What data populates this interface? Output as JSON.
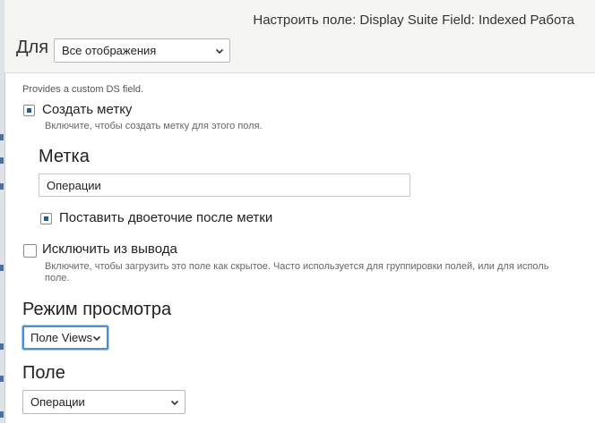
{
  "dialog": {
    "title": "Настроить поле: Display Suite Field: Indexed Работа"
  },
  "display_selector": {
    "label": "Для",
    "selected": "Все отображения"
  },
  "field_description": "Provides a custom DS field.",
  "create_label": {
    "checked": true,
    "label": "Создать метку",
    "hint": "Включите, чтобы создать метку для этого поля."
  },
  "label_section": {
    "heading": "Метка",
    "value": "Операции",
    "colon": {
      "checked": true,
      "label": "Поставить двоеточие после метки"
    }
  },
  "exclude": {
    "checked": false,
    "label": "Исключить из вывода",
    "hint_line1": "Включите, чтобы загрузить это поле как скрытое. Часто используется для группировки полей, или для исполь",
    "hint_line2": "поле."
  },
  "view_mode": {
    "heading": "Режим просмотра",
    "selected": "Поле Views"
  },
  "field": {
    "heading": "Поле",
    "selected": "Операции"
  },
  "colors": {
    "accent": "#1f5f9c",
    "focus": "#4a90d9",
    "header_bg": "#f5f5f3"
  }
}
